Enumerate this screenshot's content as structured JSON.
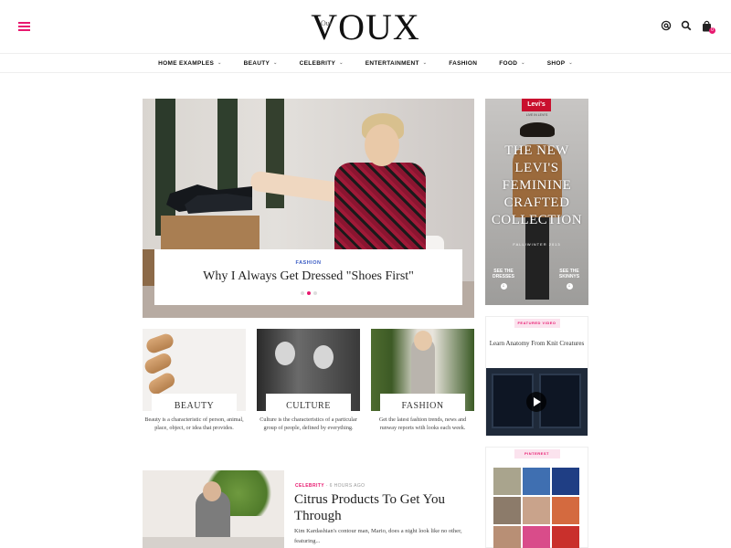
{
  "header": {
    "logo_small": "Our",
    "logo": "VOUX",
    "icons": [
      "menu-icon",
      "at-icon",
      "search-icon",
      "cart-icon"
    ],
    "cart_count": "0"
  },
  "nav": {
    "items": [
      {
        "label": "HOME EXAMPLES",
        "has_dropdown": true
      },
      {
        "label": "BEAUTY",
        "has_dropdown": true
      },
      {
        "label": "CELEBRITY",
        "has_dropdown": true
      },
      {
        "label": "ENTERTAINMENT",
        "has_dropdown": true
      },
      {
        "label": "FASHION",
        "has_dropdown": false
      },
      {
        "label": "FOOD",
        "has_dropdown": true
      },
      {
        "label": "SHOP",
        "has_dropdown": true
      }
    ]
  },
  "hero": {
    "category": "FASHION",
    "title": "Why I Always Get Dressed \"Shoes First\"",
    "slides": 3,
    "active_slide": 2
  },
  "ad": {
    "brand": "Levi's",
    "brand_sub": "LIVE IN LEVI'S",
    "headline": "THE NEW LEVI'S FEMININE CRAFTED COLLECTION",
    "season": "FALL/WINTER 2013",
    "cta_left": "SEE THE DRESSES",
    "cta_right": "SEE THE SKINNYS"
  },
  "categories": [
    {
      "label": "BEAUTY",
      "desc": "Beauty is a characteristic of person, animal, place, object, or idea that provides."
    },
    {
      "label": "CULTURE",
      "desc": "Culture is the characteristics of a particular group of people, defined by everything."
    },
    {
      "label": "FASHION",
      "desc": "Get the latest fashion trends, news and runway reports with looks each week."
    }
  ],
  "widget_video": {
    "tag": "FEATURED VIDEO",
    "title": "Learn Anatomy From Knit Creatures"
  },
  "widget_pinterest": {
    "tag": "PINTEREST"
  },
  "article": {
    "category": "CELEBRITY",
    "separator": "-",
    "time": "6 HOURS AGO",
    "title": "Citrus Products To Get You Through",
    "excerpt": "Kim Kardashian's contour man, Mario, does a night look like no other, featuring..."
  },
  "colors": {
    "accent": "#e8186f",
    "hero_category": "#3a5cc4",
    "levis_red": "#c9102e"
  }
}
